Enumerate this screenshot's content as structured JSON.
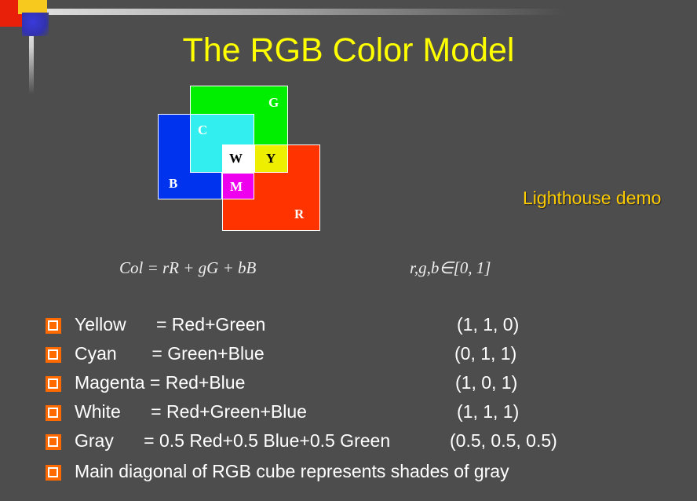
{
  "title": "The RGB Color Model",
  "diagram": {
    "labels": {
      "g": "G",
      "c": "C",
      "w": "W",
      "y": "Y",
      "b": "B",
      "m": "M",
      "r": "R"
    },
    "colors": {
      "green": "#00ee00",
      "cyan": "#33eeee",
      "blue": "#0033ee",
      "white": "#ffffff",
      "yellow": "#eeee00",
      "magenta": "#ee00ee",
      "red": "#ff3300"
    }
  },
  "demo_link": "Lighthouse demo",
  "formula": {
    "equation": "Col = rR + gG + bB",
    "range": "r,g,b∈[0, 1]"
  },
  "bullets": [
    {
      "text": "Yellow      = Red+Green",
      "vector": "(1, 1, 0)"
    },
    {
      "text": "Cyan       = Green+Blue",
      "vector": "(0, 1, 1)"
    },
    {
      "text": "Magenta = Red+Blue",
      "vector": "(1, 0, 1)"
    },
    {
      "text": "White      = Red+Green+Blue",
      "vector": "(1, 1, 1)"
    },
    {
      "text": "Gray      = 0.5 Red+0.5 Blue+0.5 Green",
      "vector": "(0.5, 0.5, 0.5)"
    },
    {
      "text": "Main diagonal of RGB cube represents shades of gray",
      "vector": ""
    }
  ]
}
